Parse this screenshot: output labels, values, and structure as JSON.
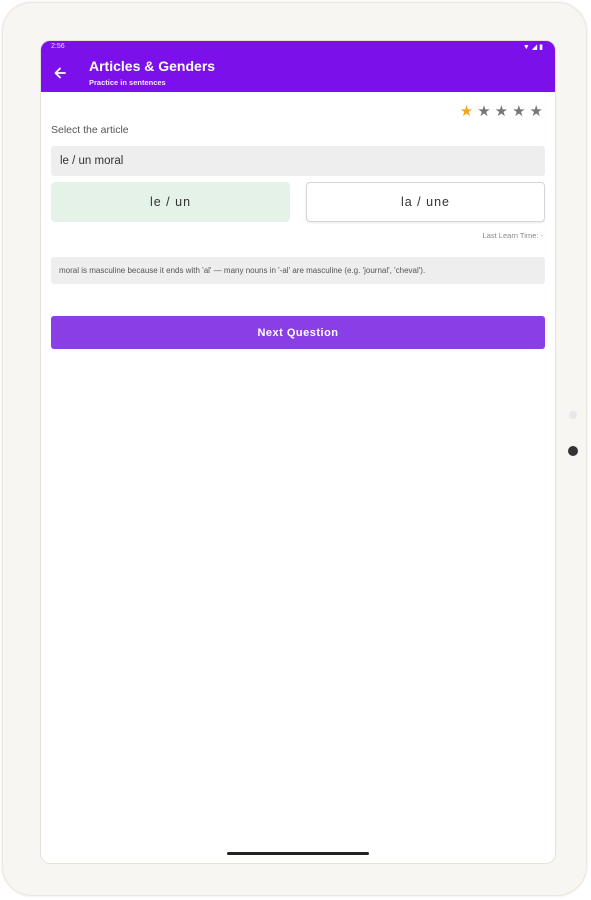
{
  "status_bar": {
    "time": "2:56",
    "icons": "▼◢▮"
  },
  "app_bar": {
    "title": "Articles & Genders",
    "subtitle": "Practice in sentences"
  },
  "rating": {
    "value": 1,
    "max": 5,
    "star_char": "★",
    "on_color": "#f4a51c",
    "off_color": "#777777"
  },
  "question": {
    "prompt": "Select the article",
    "sentence": "le / un moral"
  },
  "options": [
    {
      "label": "le / un",
      "state": "correct"
    },
    {
      "label": "la / une",
      "state": "default"
    }
  ],
  "last_learn_time": "Last Learn Time: -",
  "explanation": "moral is masculine because it ends with 'al' — many nouns in '-al' are masculine (e.g. 'journal', 'cheval').",
  "next_button": "Next Question",
  "colors": {
    "accent": "#7c10ea",
    "button": "#8a3fe6",
    "correct_bg": "#e5f2e8"
  }
}
